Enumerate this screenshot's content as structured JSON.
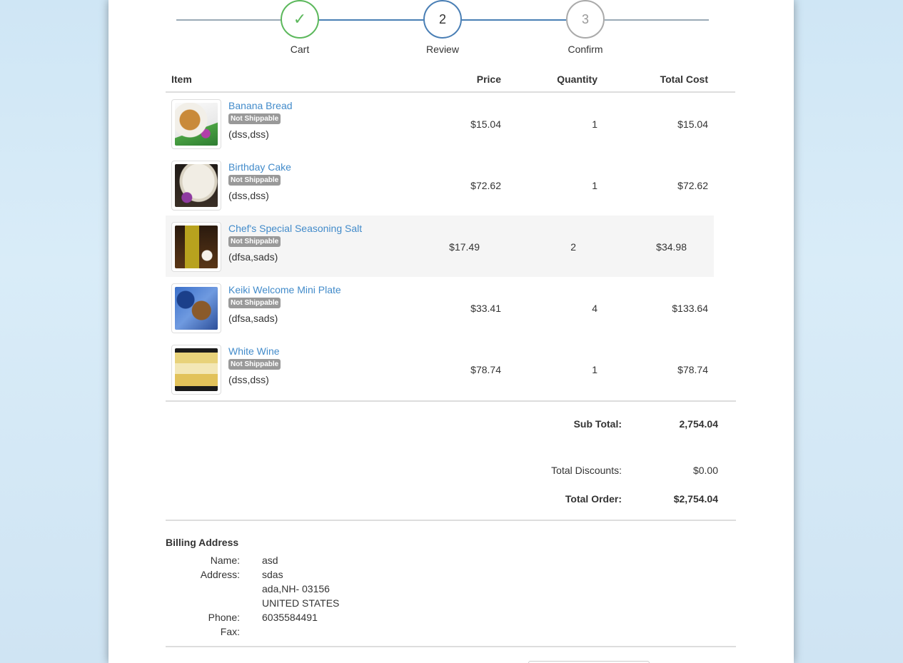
{
  "stepper": {
    "steps": [
      {
        "label": "Cart",
        "marker": "✓",
        "state": "done"
      },
      {
        "label": "Review",
        "marker": "2",
        "state": "current"
      },
      {
        "label": "Confirm",
        "marker": "3",
        "state": "pending"
      }
    ]
  },
  "table": {
    "headers": {
      "item": "Item",
      "price": "Price",
      "quantity": "Quantity",
      "total": "Total Cost"
    },
    "rows": [
      {
        "name": "Banana Bread",
        "badge": "Not Shippable",
        "variant": "(dss,dss)",
        "price": "$15.04",
        "qty": "1",
        "total": "$15.04"
      },
      {
        "name": "Birthday Cake",
        "badge": "Not Shippable",
        "variant": "(dss,dss)",
        "price": "$72.62",
        "qty": "1",
        "total": "$72.62"
      },
      {
        "name": "Chef's Special Seasoning Salt",
        "badge": "Not Shippable",
        "variant": "(dfsa,sads)",
        "price": "$17.49",
        "qty": "2",
        "total": "$34.98"
      },
      {
        "name": "Keiki Welcome Mini Plate",
        "badge": "Not Shippable",
        "variant": "(dfsa,sads)",
        "price": "$33.41",
        "qty": "4",
        "total": "$133.64"
      },
      {
        "name": "White Wine",
        "badge": "Not Shippable",
        "variant": "(dss,dss)",
        "price": "$78.74",
        "qty": "1",
        "total": "$78.74"
      }
    ]
  },
  "totals": {
    "subtotal_label": "Sub Total:",
    "subtotal": "2,754.04",
    "discounts_label": "Total Discounts:",
    "discounts": "$0.00",
    "order_label": "Total Order:",
    "order": "$2,754.04"
  },
  "billing": {
    "title": "Billing Address",
    "name_label": "Name:",
    "name": "asd",
    "address_label": "Address:",
    "address1": "sdas",
    "address2": "ada,NH- 03156",
    "address3": "UNITED STATES",
    "phone_label": "Phone:",
    "phone": "6035584491",
    "fax_label": "Fax:"
  },
  "colors": {
    "accent": "#428bca",
    "done": "#5cb85c",
    "badge": "#999999"
  }
}
